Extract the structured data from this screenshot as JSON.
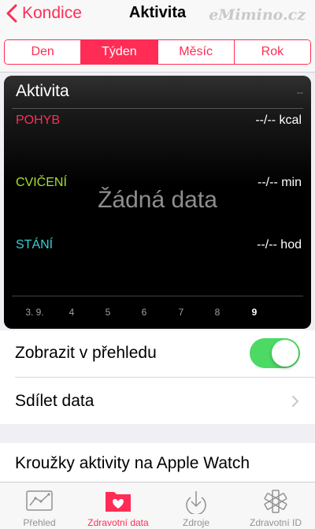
{
  "nav": {
    "back_label": "Kondice",
    "title": "Aktivita",
    "watermark": "eMimino.cz"
  },
  "segments": [
    {
      "label": "Den",
      "active": false
    },
    {
      "label": "Týden",
      "active": true
    },
    {
      "label": "Měsíc",
      "active": false
    },
    {
      "label": "Rok",
      "active": false
    }
  ],
  "card": {
    "title": "Aktivita",
    "title_value": "--",
    "metrics": [
      {
        "label": "POHYB",
        "value": "--/-- kcal",
        "color": "#ff2d55"
      },
      {
        "label": "CVIČENÍ",
        "value": "--/-- min",
        "color": "#a7e22e"
      },
      {
        "label": "STÁNÍ",
        "value": "--/-- hod",
        "color": "#33d1d6"
      }
    ],
    "no_data": "Žádná data",
    "days": [
      "3. 9.",
      "4",
      "5",
      "6",
      "7",
      "8",
      "9"
    ]
  },
  "settings": {
    "show_in_overview": "Zobrazit v přehledu",
    "show_in_overview_on": true,
    "share_data": "Sdílet data",
    "apple_watch_rings": "Kroužky aktivity na Apple Watch"
  },
  "tabs": [
    {
      "label": "Přehled",
      "icon": "overview-chart-icon"
    },
    {
      "label": "Zdravotní data",
      "icon": "health-data-heart-icon",
      "active": true
    },
    {
      "label": "Zdroje",
      "icon": "sources-download-icon"
    },
    {
      "label": "Zdravotní ID",
      "icon": "medical-id-asterisk-icon"
    }
  ],
  "colors": {
    "accent": "#ff2d55",
    "toggle_on": "#4cd964"
  }
}
